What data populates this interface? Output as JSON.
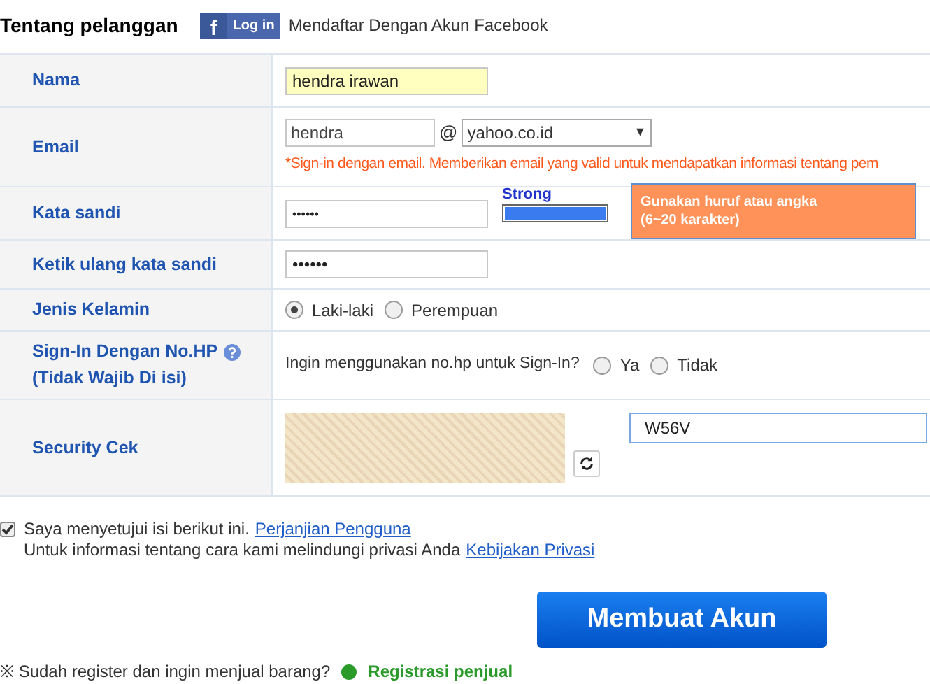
{
  "header": {
    "title": "Tentang pelanggan",
    "facebook_button": {
      "icon_letter": "f",
      "label": "Log in"
    },
    "facebook_text": "Mendaftar Dengan Akun Facebook"
  },
  "rows": [
    {
      "kind": "text",
      "label": "Nama",
      "value": "hendra irawan"
    },
    {
      "kind": "email",
      "label": "Email",
      "user": "hendra",
      "at": "@",
      "domain": "yahoo.co.id",
      "caret": "▼",
      "hint": "*Sign-in dengan email. Memberikan email yang valid untuk mendapatkan informasi tentang pem"
    },
    {
      "kind": "password",
      "label": "Kata sandi",
      "value": "••••••",
      "strength_label": "Strong",
      "level": 1,
      "tooltip": [
        "Gunakan huruf atau angka",
        "(6~20 karakter)"
      ]
    },
    {
      "kind": "text",
      "label": "Ketik ulang kata sandi",
      "value": "••••••"
    },
    {
      "kind": "radio",
      "label": "Jenis Kelamin",
      "options": [
        {
          "label": "Laki-laki",
          "selected": true
        },
        {
          "label": "Perempuan",
          "selected": false
        }
      ]
    },
    {
      "kind": "phone",
      "label": "Sign-In Dengan No.HP",
      "sublabel": "(Tidak Wajib Di isi)",
      "question": "Ingin menggunakan no.hp untuk Sign-In?",
      "options": [
        {
          "label": "Ya",
          "selected": false
        },
        {
          "label": "Tidak",
          "selected": false
        }
      ]
    },
    {
      "kind": "captcha",
      "label": "Security Cek",
      "value": "W56V"
    }
  ],
  "agreement": {
    "checked": true,
    "line1": "Saya menyetujui isi berikut ini.",
    "link1": "Perjanjian Pengguna",
    "line2": "Untuk informasi tentang cara kami melindungi privasi Anda",
    "link2": "Kebijakan Privasi"
  },
  "submit": "Membuat Akun",
  "footer": {
    "text": "※ Sudah register dan ingin menjual barang?",
    "link": "Registrasi penjual"
  }
}
